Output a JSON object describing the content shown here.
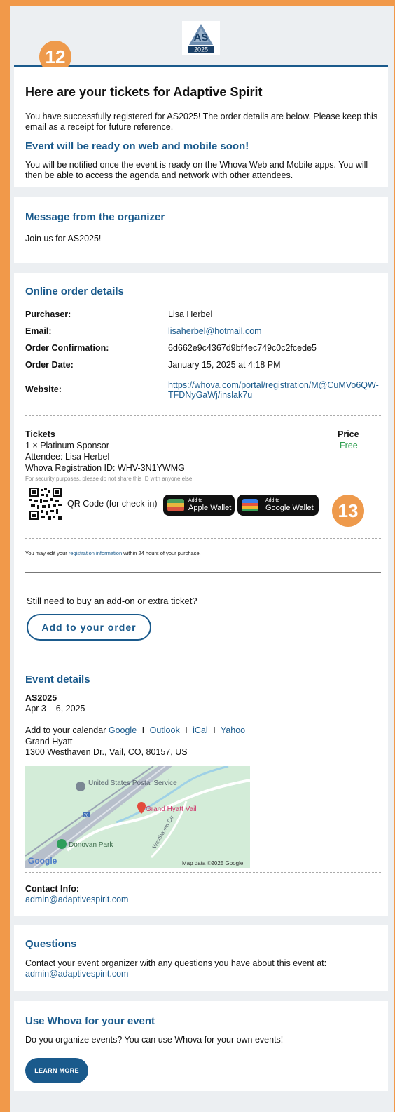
{
  "header": {
    "logo_text": "AS",
    "logo_year": "2025",
    "badge_left": "12",
    "badge_right": "13"
  },
  "intro": {
    "title": "Here are your tickets for Adaptive Spirit",
    "body": "You have successfully registered for AS2025! The order details are below. Please keep this email as a receipt for future reference.",
    "subheading": "Event will be ready on web and mobile soon!",
    "sub_body": "You will be notified once the event is ready on the Whova Web and Mobile apps. You will then be able to access the agenda and network with other attendees."
  },
  "organizer": {
    "title": "Message from the organizer",
    "message": "Join us for AS2025!"
  },
  "order": {
    "title": "Online order details",
    "rows": [
      {
        "label": "Purchaser:",
        "value": "Lisa Herbel"
      },
      {
        "label": "Email:",
        "value": "lisaherbel@hotmail.com"
      },
      {
        "label": "Order Confirmation:",
        "value": "6d662e9c4367d9bf4ec749c0c2fcede5"
      },
      {
        "label": "Order Date:",
        "value": "January 15, 2025 at 4:18 PM"
      },
      {
        "label": "Website:",
        "value": "https://whova.com/portal/registration/M@CuMVo6QW-TFDNyGaWj/inslak7u"
      }
    ]
  },
  "tickets": {
    "heading": "Tickets",
    "price_heading": "Price",
    "item": "1 × Platinum Sponsor",
    "price": "Free",
    "attendee": "Attendee: Lisa Herbel",
    "reg_id": "Whova Registration ID: WHV-3N1YWMG",
    "security_note": "For security purposes, please do not share this ID with anyone else.",
    "qr_label": "QR Code (for check-in)",
    "apple_small": "Add to",
    "apple_large": "Apple Wallet",
    "google_small": "Add to",
    "google_large": "Google Wallet",
    "edit_before": "You may edit your ",
    "edit_link": "registration information",
    "edit_after": " within 24 hours of your purchase.",
    "addon_prompt": "Still need to buy an add-on or extra ticket?",
    "add_button": "Add to your order"
  },
  "event": {
    "title": "Event details",
    "name": "AS2025",
    "dates": "Apr 3 – 6, 2025",
    "calendar_prefix": "Add to your calendar",
    "calendar_links": [
      "Google",
      "Outlook",
      "iCal",
      "Yahoo"
    ],
    "separator": "I",
    "venue": "Grand Hyatt",
    "address": "1300 Westhaven Dr., Vail, CO, 80157, US",
    "map": {
      "poi_postal": "United States Postal Service",
      "poi_hotel": "Grand Hyatt Vail",
      "poi_park": "Donovan Park",
      "road": "Westhaven Cir",
      "interstate": "70",
      "brand": "Google",
      "attribution": "Map data ©2025 Google"
    },
    "contact_label": "Contact Info:",
    "contact_email": "admin@adaptivespirit.com"
  },
  "questions": {
    "title": "Questions",
    "body": "Contact your event organizer with any questions you have about this event at:",
    "email": "admin@adaptivespirit.com"
  },
  "whova": {
    "title": "Use Whova for your event",
    "body": "Do you organize events? You can use Whova for your own events!",
    "button": "LEARN MORE"
  }
}
